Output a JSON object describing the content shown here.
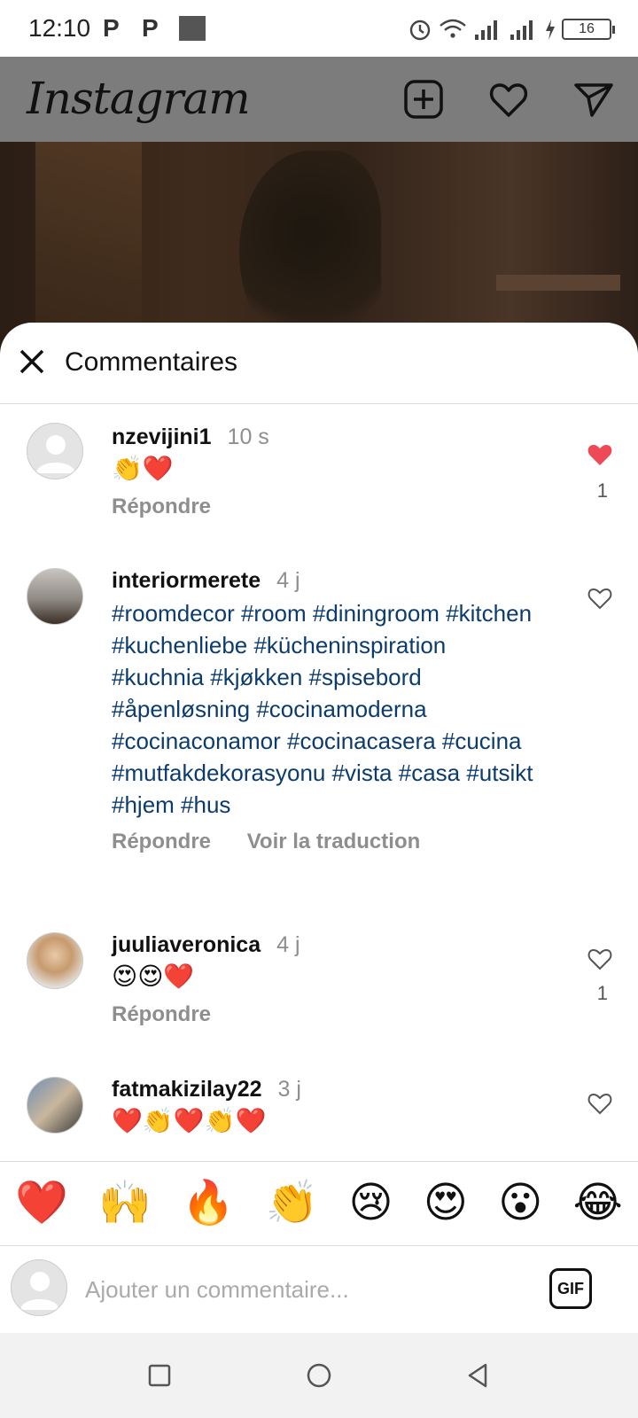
{
  "status_bar": {
    "time": "12:10",
    "notif_icons": [
      "P",
      "P"
    ],
    "battery": "16"
  },
  "header": {
    "logo": "Instagram",
    "icons": [
      "new-post-icon",
      "heart-icon",
      "direct-message-icon"
    ]
  },
  "sheet": {
    "title": "Commentaires"
  },
  "comments": [
    {
      "username": "nzevijini1",
      "time": "10 s",
      "text": "👏❤️",
      "liked": true,
      "like_count": "1",
      "actions": [
        "Répondre"
      ]
    },
    {
      "username": "interiormerete",
      "time": "4 j",
      "text": "#roomdecor #room #diningroom #kitchen #kuchenliebe #kücheninspiration #kuchnia #kjøkken #spisebord #åpenløsning #cocinamoderna #cocinaconamor #cocinacasera #cucina #mutfakdekorasyonu #vista #casa #utsikt #hjem #hus",
      "liked": false,
      "like_count": "",
      "actions": [
        "Répondre",
        "Voir la traduction"
      ]
    },
    {
      "username": "juuliaveronica",
      "time": "4 j",
      "text": "😍😍❤️",
      "liked": false,
      "like_count": "1",
      "actions": [
        "Répondre"
      ]
    },
    {
      "username": "fatmakizilay22",
      "time": "3 j",
      "text": "❤️👏❤️👏❤️",
      "liked": false,
      "like_count": "",
      "actions": []
    }
  ],
  "reactions": [
    "❤️",
    "🙌",
    "🔥",
    "👏",
    "😢",
    "😍",
    "😮",
    "😂"
  ],
  "input": {
    "placeholder": "Ajouter un commentaire...",
    "gif_label": "GIF"
  },
  "colors": {
    "hashtag": "#0c3c6e",
    "like_red": "#ed4956",
    "muted": "#8e8e8e"
  }
}
